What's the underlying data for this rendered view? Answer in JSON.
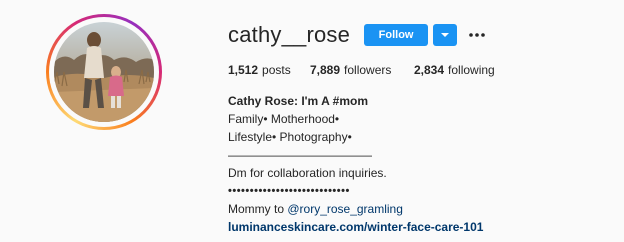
{
  "profile": {
    "username": "cathy__rose",
    "follow_label": "Follow"
  },
  "stats": {
    "posts_count": "1,512",
    "posts_label": "posts",
    "followers_count": "7,889",
    "followers_label": "followers",
    "following_count": "2,834",
    "following_label": "following"
  },
  "bio": {
    "name": "Cathy Rose: I'm A #mom",
    "line1": "Family• Motherhood•",
    "line2": "Lifestyle• Photography•",
    "divider": "————————————",
    "line3": "Dm for collaboration inquiries.",
    "dots": "••••••••••••••••••••••••••••",
    "mommy_prefix": "Mommy to ",
    "mommy_mention": "@rory_rose_gramling",
    "website": "luminanceskincare.com/winter-face-care-101"
  },
  "colors": {
    "accent": "#1a93f3",
    "link": "#00376b",
    "background": "#fafafa"
  },
  "icons": {
    "dropdown": "chevron-down-icon",
    "more": "more-options-icon"
  }
}
